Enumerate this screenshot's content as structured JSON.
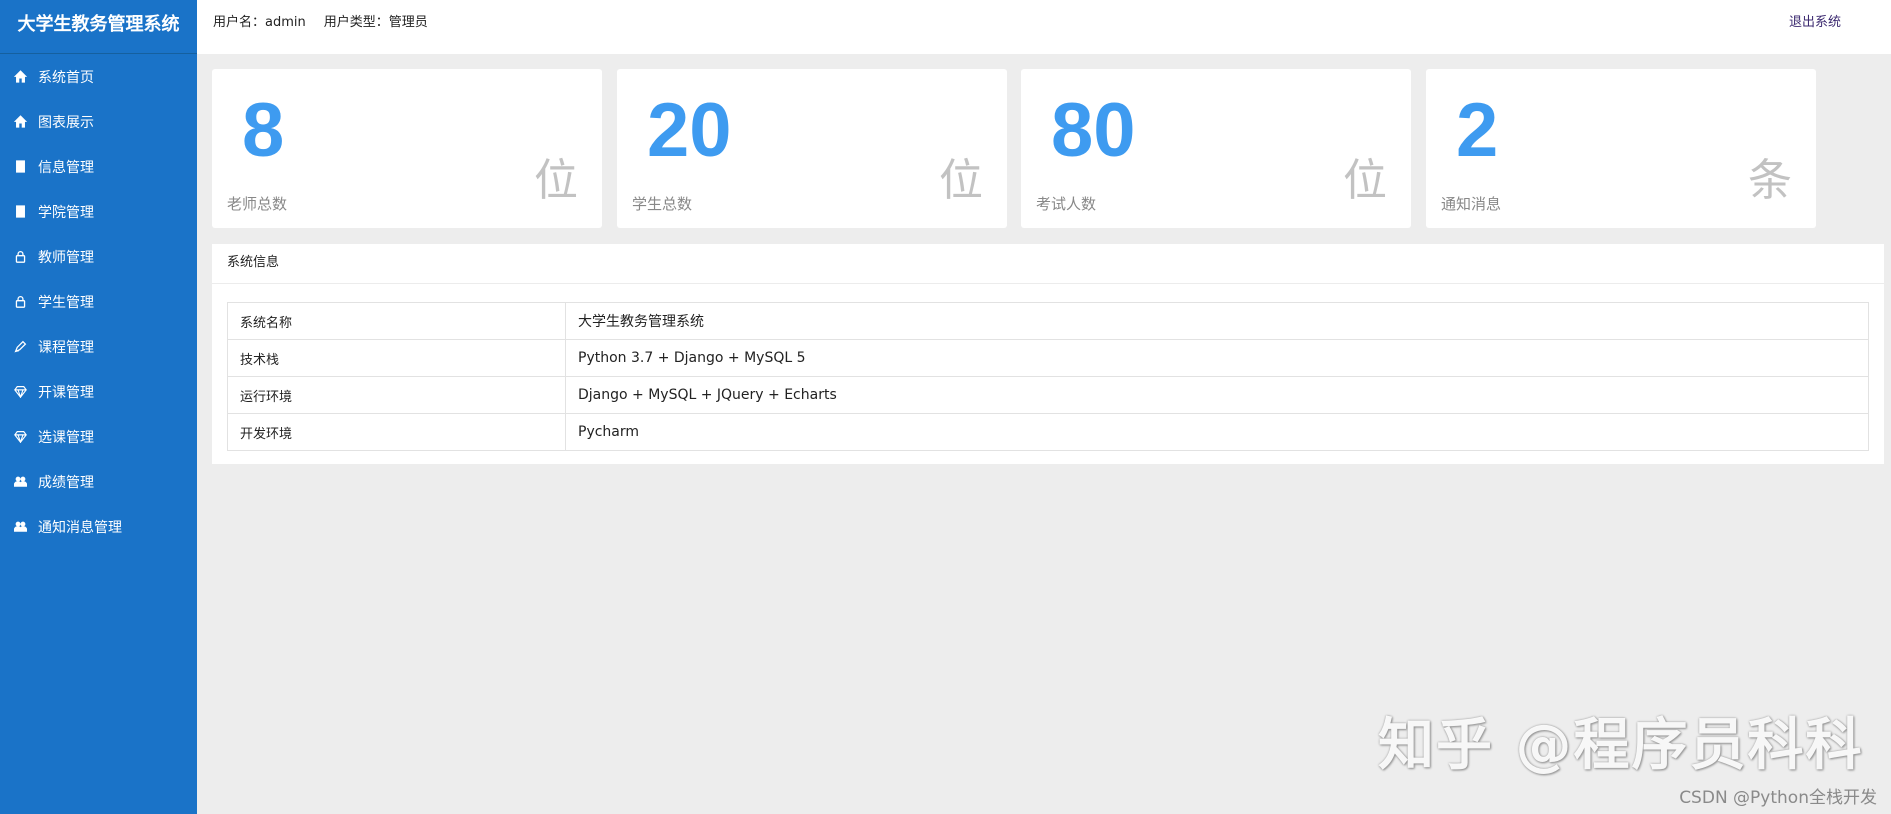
{
  "app": {
    "title": "大学生教务管理系统"
  },
  "sidebar": {
    "items": [
      {
        "label": "系统首页",
        "icon": "home-icon"
      },
      {
        "label": "图表展示",
        "icon": "home-icon"
      },
      {
        "label": "信息管理",
        "icon": "book-icon"
      },
      {
        "label": "学院管理",
        "icon": "book-icon"
      },
      {
        "label": "教师管理",
        "icon": "lock-icon"
      },
      {
        "label": "学生管理",
        "icon": "lock-icon"
      },
      {
        "label": "课程管理",
        "icon": "pen-icon"
      },
      {
        "label": "开课管理",
        "icon": "diamond-icon"
      },
      {
        "label": "选课管理",
        "icon": "diamond-icon"
      },
      {
        "label": "成绩管理",
        "icon": "users-icon"
      },
      {
        "label": "通知消息管理",
        "icon": "users-icon"
      }
    ]
  },
  "header": {
    "username_label": "用户名：admin",
    "usertype_label": "用户类型：管理员",
    "logout_label": "退出系统"
  },
  "stats": [
    {
      "value": "8",
      "label": "老师总数",
      "unit": "位"
    },
    {
      "value": "20",
      "label": "学生总数",
      "unit": "位"
    },
    {
      "value": "80",
      "label": "考试人数",
      "unit": "位"
    },
    {
      "value": "2",
      "label": "通知消息",
      "unit": "条"
    }
  ],
  "system_info": {
    "title": "系统信息",
    "rows": [
      {
        "key": "系统名称",
        "value": "大学生教务管理系统"
      },
      {
        "key": "技术栈",
        "value": "Python 3.7 + Django + MySQL 5"
      },
      {
        "key": "运行环境",
        "value": "Django + MySQL + JQuery + Echarts"
      },
      {
        "key": "开发环境",
        "value": "Pycharm"
      }
    ]
  },
  "watermarks": {
    "zhihu": "知乎 @程序员科科",
    "csdn": "CSDN @Python全栈开发"
  },
  "colors": {
    "sidebar_bg": "#1a73c8",
    "stat_number": "#3e9bf0",
    "page_bg": "#ededed"
  }
}
